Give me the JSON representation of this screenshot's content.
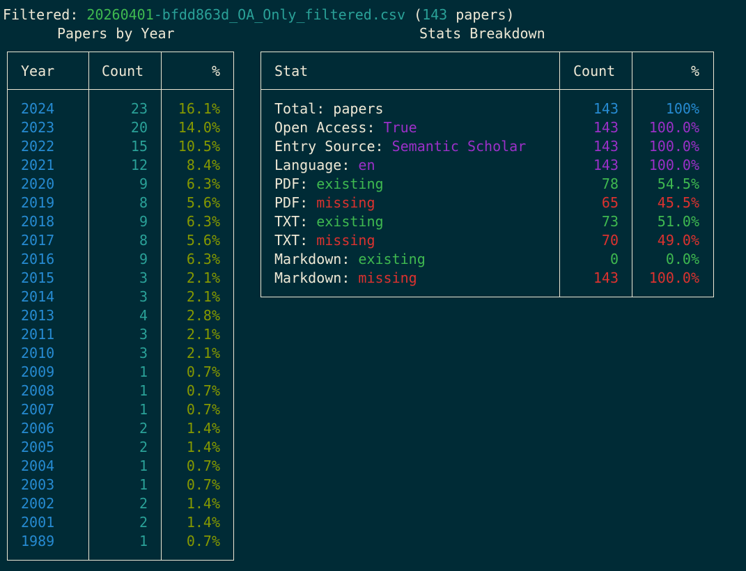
{
  "header": {
    "label": "Filtered:",
    "file_date": "20260401",
    "file_rest": "-bfdd863d_OA_Only_filtered.csv",
    "paren_open": "(",
    "count": "143",
    "count_suffix": " papers)"
  },
  "year_table": {
    "title": "Papers by Year",
    "columns": [
      "Year",
      "Count",
      "%"
    ],
    "rows": [
      {
        "year": "2024",
        "count": "23",
        "pct": "16.1%"
      },
      {
        "year": "2023",
        "count": "20",
        "pct": "14.0%"
      },
      {
        "year": "2022",
        "count": "15",
        "pct": "10.5%"
      },
      {
        "year": "2021",
        "count": "12",
        "pct": "8.4%"
      },
      {
        "year": "2020",
        "count": "9",
        "pct": "6.3%"
      },
      {
        "year": "2019",
        "count": "8",
        "pct": "5.6%"
      },
      {
        "year": "2018",
        "count": "9",
        "pct": "6.3%"
      },
      {
        "year": "2017",
        "count": "8",
        "pct": "5.6%"
      },
      {
        "year": "2016",
        "count": "9",
        "pct": "6.3%"
      },
      {
        "year": "2015",
        "count": "3",
        "pct": "2.1%"
      },
      {
        "year": "2014",
        "count": "3",
        "pct": "2.1%"
      },
      {
        "year": "2013",
        "count": "4",
        "pct": "2.8%"
      },
      {
        "year": "2011",
        "count": "3",
        "pct": "2.1%"
      },
      {
        "year": "2010",
        "count": "3",
        "pct": "2.1%"
      },
      {
        "year": "2009",
        "count": "1",
        "pct": "0.7%"
      },
      {
        "year": "2008",
        "count": "1",
        "pct": "0.7%"
      },
      {
        "year": "2007",
        "count": "1",
        "pct": "0.7%"
      },
      {
        "year": "2006",
        "count": "2",
        "pct": "1.4%"
      },
      {
        "year": "2005",
        "count": "2",
        "pct": "1.4%"
      },
      {
        "year": "2004",
        "count": "1",
        "pct": "0.7%"
      },
      {
        "year": "2003",
        "count": "1",
        "pct": "0.7%"
      },
      {
        "year": "2002",
        "count": "2",
        "pct": "1.4%"
      },
      {
        "year": "2001",
        "count": "2",
        "pct": "1.4%"
      },
      {
        "year": "1989",
        "count": "1",
        "pct": "0.7%"
      }
    ]
  },
  "stats_table": {
    "title": "Stats Breakdown",
    "columns": [
      "Stat",
      "Count",
      "%"
    ],
    "rows": [
      {
        "key": "Total:",
        "value": "papers",
        "value_color": "white",
        "count": "143",
        "pct": "100%",
        "num_color": "blue"
      },
      {
        "key": "Open Access:",
        "value": "True",
        "value_color": "magenta",
        "count": "143",
        "pct": "100.0%",
        "num_color": "magenta"
      },
      {
        "key": "Entry Source:",
        "value": "Semantic Scholar",
        "value_color": "magenta",
        "count": "143",
        "pct": "100.0%",
        "num_color": "magenta"
      },
      {
        "key": "Language:",
        "value": "en",
        "value_color": "magenta",
        "count": "143",
        "pct": "100.0%",
        "num_color": "magenta"
      },
      {
        "key": "PDF:",
        "value": "existing",
        "value_color": "green",
        "count": "78",
        "pct": "54.5%",
        "num_color": "green"
      },
      {
        "key": "PDF:",
        "value": "missing",
        "value_color": "red",
        "count": "65",
        "pct": "45.5%",
        "num_color": "red"
      },
      {
        "key": "TXT:",
        "value": "existing",
        "value_color": "green",
        "count": "73",
        "pct": "51.0%",
        "num_color": "green"
      },
      {
        "key": "TXT:",
        "value": "missing",
        "value_color": "red",
        "count": "70",
        "pct": "49.0%",
        "num_color": "red"
      },
      {
        "key": "Markdown:",
        "value": "existing",
        "value_color": "green",
        "count": "0",
        "pct": "0.0%",
        "num_color": "green"
      },
      {
        "key": "Markdown:",
        "value": "missing",
        "value_color": "red",
        "count": "143",
        "pct": "100.0%",
        "num_color": "red"
      }
    ]
  },
  "colors": {
    "background": "#002b36",
    "text": "#eee8d5",
    "teal": "#2aa198",
    "blue": "#268bd2",
    "yellowgreen": "#859900",
    "green": "#3fb950",
    "red": "#dc322f",
    "magenta": "#9b30c8"
  }
}
